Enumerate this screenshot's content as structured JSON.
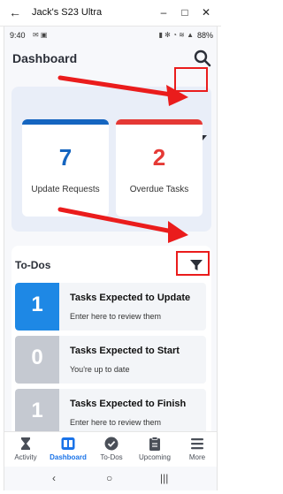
{
  "window": {
    "title": "Jack's S23 Ultra",
    "back_glyph": "←",
    "minimize_glyph": "–",
    "maximize_glyph": "□",
    "close_glyph": "✕"
  },
  "status_bar": {
    "time": "9:40",
    "left_icons": "✉ ▣",
    "right_icons": "▮ ✻ ◔ ≋ ▲",
    "battery": "88%"
  },
  "header": {
    "title": "Dashboard",
    "search_icon": "search-icon"
  },
  "summary": {
    "filter_icon": "filter-icon",
    "tiles": [
      {
        "value": "7",
        "label": "Update Requests",
        "color": "#1565c0"
      },
      {
        "value": "2",
        "label": "Overdue Tasks",
        "color": "#e53935"
      }
    ]
  },
  "todos": {
    "title": "To-Dos",
    "filter_icon": "filter-icon",
    "items": [
      {
        "count": "1",
        "title": "Tasks Expected to Update",
        "subtitle": "Enter here to review them",
        "color": "#1e88e5"
      },
      {
        "count": "0",
        "title": "Tasks Expected to Start",
        "subtitle": "You're up to date",
        "color": "#c5c9d1"
      },
      {
        "count": "1",
        "title": "Tasks Expected to Finish",
        "subtitle": "Enter here to review them",
        "color": "#c5c9d1"
      }
    ]
  },
  "tabs": [
    {
      "label": "Activity",
      "icon": "hourglass-icon"
    },
    {
      "label": "Dashboard",
      "icon": "dashboard-icon",
      "active": true
    },
    {
      "label": "To-Dos",
      "icon": "check-circle-icon"
    },
    {
      "label": "Upcoming",
      "icon": "clipboard-icon"
    },
    {
      "label": "More",
      "icon": "menu-icon"
    }
  ],
  "nav": {
    "back": "‹",
    "home": "○",
    "recents": "|||"
  },
  "colors": {
    "accent": "#1a73e8",
    "annotation_red": "#ea1c1c"
  }
}
